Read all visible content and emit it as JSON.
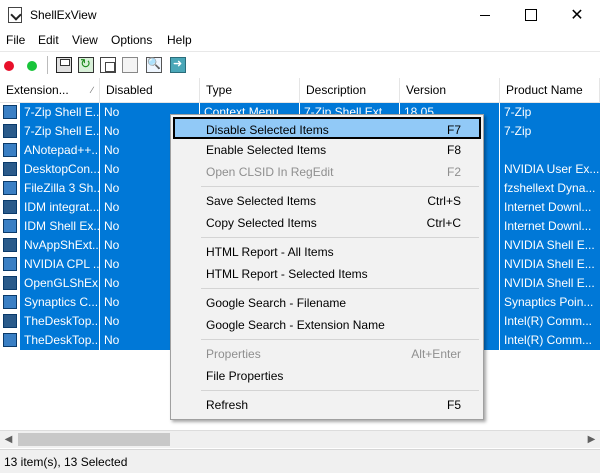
{
  "window": {
    "title": "ShellExView"
  },
  "menubar": [
    "File",
    "Edit",
    "View",
    "Options",
    "Help"
  ],
  "columns": [
    "Extension...",
    "Disabled",
    "Type",
    "Description",
    "Version",
    "Product Name"
  ],
  "rows": [
    {
      "name": "7-Zip Shell E...",
      "disabled": "No",
      "type": "Context Menu",
      "description": "7-Zip Shell Ext...",
      "version": "18.05",
      "product": "7-Zip"
    },
    {
      "name": "7-Zip Shell E...",
      "disabled": "No",
      "type": "",
      "description": "",
      "version": "",
      "product": "7-Zip"
    },
    {
      "name": "ANotepad++...",
      "disabled": "No",
      "type": "",
      "description": "",
      "version": "",
      "product": ""
    },
    {
      "name": "DesktopCon...",
      "disabled": "No",
      "type": "",
      "description": "",
      "version": "",
      "product": "NVIDIA User Ex..."
    },
    {
      "name": "FileZilla 3 Sh...",
      "disabled": "No",
      "type": "",
      "description": "",
      "version": "",
      "product": "fzshellext Dyna..."
    },
    {
      "name": "IDM integrat...",
      "disabled": "No",
      "type": "",
      "description": "",
      "version": "",
      "product": "Internet Downl..."
    },
    {
      "name": "IDM Shell Ex...",
      "disabled": "No",
      "type": "",
      "description": "",
      "version": "",
      "product": "Internet Downl..."
    },
    {
      "name": "NvAppShExt...",
      "disabled": "No",
      "type": "",
      "description": "",
      "version": "",
      "product": "NVIDIA Shell E..."
    },
    {
      "name": "NVIDIA CPL ...",
      "disabled": "No",
      "type": "",
      "description": "",
      "version": "",
      "product": "NVIDIA Shell E..."
    },
    {
      "name": "OpenGLShEx...",
      "disabled": "No",
      "type": "",
      "description": "",
      "version": "",
      "product": "NVIDIA Shell E..."
    },
    {
      "name": "Synaptics C...",
      "disabled": "No",
      "type": "",
      "description": "",
      "version": "",
      "product": "Synaptics Poin..."
    },
    {
      "name": "TheDeskTop...",
      "disabled": "No",
      "type": "",
      "description": "",
      "version": "",
      "product": "Intel(R) Comm..."
    },
    {
      "name": "TheDeskTop...",
      "disabled": "No",
      "type": "",
      "description": "",
      "version": "",
      "product": "Intel(R) Comm..."
    }
  ],
  "context_menu": [
    {
      "label": "Disable Selected Items",
      "shortcut": "F7",
      "state": "selected"
    },
    {
      "label": "Enable Selected Items",
      "shortcut": "F8",
      "state": "normal"
    },
    {
      "label": "Open CLSID In RegEdit",
      "shortcut": "F2",
      "state": "disabled"
    },
    {
      "separator": true
    },
    {
      "label": "Save Selected Items",
      "shortcut": "Ctrl+S",
      "state": "normal"
    },
    {
      "label": "Copy Selected Items",
      "shortcut": "Ctrl+C",
      "state": "normal"
    },
    {
      "separator": true
    },
    {
      "label": "HTML Report - All Items",
      "shortcut": "",
      "state": "normal"
    },
    {
      "label": "HTML Report - Selected Items",
      "shortcut": "",
      "state": "normal"
    },
    {
      "separator": true
    },
    {
      "label": "Google Search - Filename",
      "shortcut": "",
      "state": "normal"
    },
    {
      "label": "Google Search - Extension Name",
      "shortcut": "",
      "state": "normal"
    },
    {
      "separator": true
    },
    {
      "label": "Properties",
      "shortcut": "Alt+Enter",
      "state": "disabled"
    },
    {
      "label": "File Properties",
      "shortcut": "",
      "state": "normal"
    },
    {
      "separator": true
    },
    {
      "label": "Refresh",
      "shortcut": "F5",
      "state": "normal"
    }
  ],
  "status": {
    "text": "13 item(s), 13 Selected"
  },
  "colors": {
    "selection": "#0078d7",
    "menu_highlight": "#91c9f7",
    "menu_bg": "#f2f2f2"
  }
}
